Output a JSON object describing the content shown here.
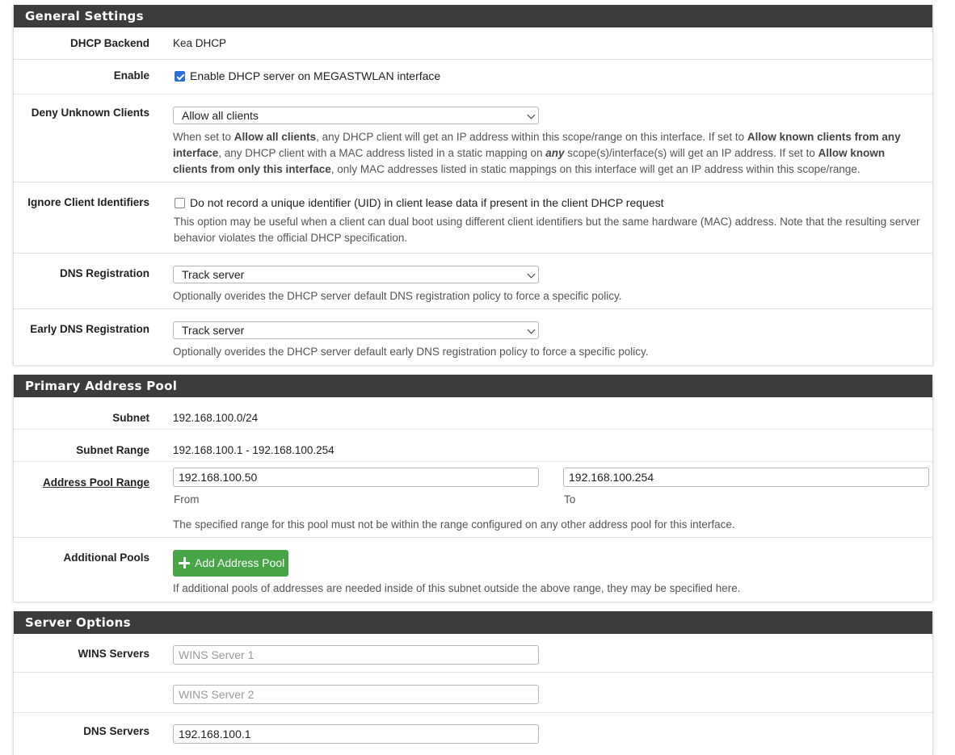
{
  "general": {
    "title": "General Settings",
    "dhcp_backend": {
      "label": "DHCP Backend",
      "value": "Kea DHCP"
    },
    "enable": {
      "label": "Enable",
      "checked": true,
      "text": "Enable DHCP server on MEGASTWLAN interface"
    },
    "deny_unknown": {
      "label": "Deny Unknown Clients",
      "selected": "Allow all clients",
      "help": {
        "p1": "When set to ",
        "b1": "Allow all clients",
        "p2": ", any DHCP client will get an IP address within this scope/range on this interface. If set to ",
        "b2": "Allow known clients from any interface",
        "p3": ", any DHCP client with a MAC address listed in a static mapping on ",
        "b3": "any",
        "p4": " scope(s)/interface(s) will get an IP address. If set to ",
        "b4": "Allow known clients from only this interface",
        "p5": ", only MAC addresses listed in static mappings on this interface will get an IP address within this scope/range."
      }
    },
    "ignore_uid": {
      "label": "Ignore Client Identifiers",
      "checked": false,
      "text": "Do not record a unique identifier (UID) in client lease data if present in the client DHCP request",
      "help": "This option may be useful when a client can dual boot using different client identifiers but the same hardware (MAC) address. Note that the resulting server behavior violates the official DHCP specification."
    },
    "dns_registration": {
      "label": "DNS Registration",
      "selected": "Track server",
      "help": "Optionally overides the DHCP server default DNS registration policy to force a specific policy."
    },
    "early_dns_registration": {
      "label": "Early DNS Registration",
      "selected": "Track server",
      "help": "Optionally overides the DHCP server default early DNS registration policy to force a specific policy."
    }
  },
  "pool": {
    "title": "Primary Address Pool",
    "subnet": {
      "label": "Subnet",
      "value": "192.168.100.0/24"
    },
    "subnet_range": {
      "label": "Subnet Range",
      "value": "192.168.100.1 - 192.168.100.254"
    },
    "range": {
      "label": "Address Pool Range",
      "from_value": "192.168.100.50",
      "from_label": "From",
      "to_value": "192.168.100.254",
      "to_label": "To",
      "help": "The specified range for this pool must not be within the range configured on any other address pool for this interface."
    },
    "additional": {
      "label": "Additional Pools",
      "button": "Add Address Pool",
      "help": "If additional pools of addresses are needed inside of this subnet outside the above range, they may be specified here."
    }
  },
  "server": {
    "title": "Server Options",
    "wins": {
      "label": "WINS Servers",
      "placeholder1": "WINS Server 1",
      "placeholder2": "WINS Server 2"
    },
    "dns": {
      "label": "DNS Servers",
      "value1": "192.168.100.1"
    }
  },
  "colors": {
    "heading_bg": "#3c3c3c",
    "button_green": "#47a447",
    "checkbox_blue": "#2b70d9"
  }
}
